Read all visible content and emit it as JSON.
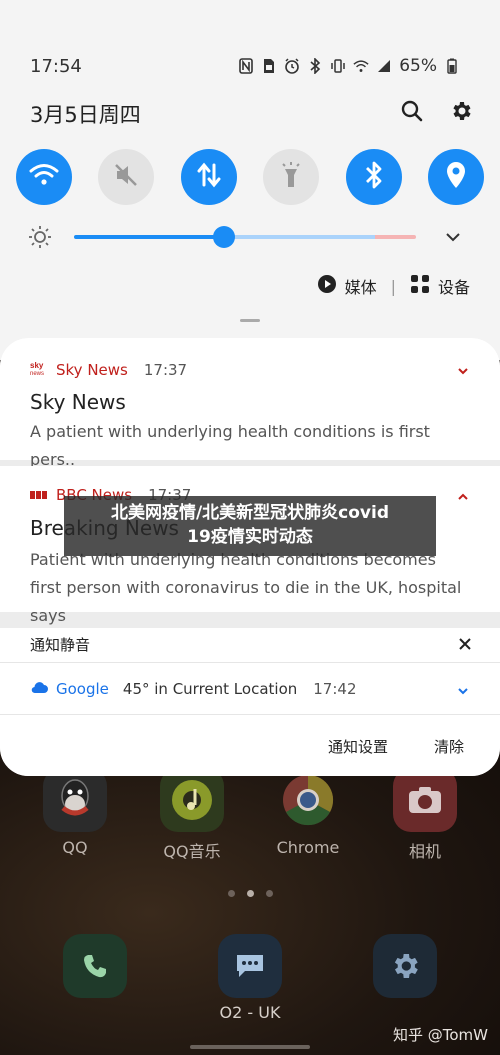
{
  "status_bar": {
    "time": "17:54",
    "battery": "65%",
    "icons": [
      "nfc-icon",
      "sim-icon",
      "alarm-icon",
      "bluetooth-icon",
      "vibrate-icon",
      "wifi-icon",
      "signal-icon",
      "battery-icon"
    ]
  },
  "header": {
    "date": "3月5日周四",
    "icons": [
      "search-icon",
      "gear-icon"
    ]
  },
  "quick_tiles": [
    {
      "icon": "wifi-icon",
      "active": true
    },
    {
      "icon": "mute-icon",
      "active": false
    },
    {
      "icon": "data-transfer-icon",
      "active": true
    },
    {
      "icon": "flashlight-icon",
      "active": false
    },
    {
      "icon": "bluetooth-icon",
      "active": true
    },
    {
      "icon": "location-icon",
      "active": true
    }
  ],
  "brightness": {
    "level": 0.44
  },
  "media_row": {
    "media_label": "媒体",
    "devices_label": "设备",
    "separator": "|"
  },
  "notifications": {
    "sky": {
      "app_name": "Sky News",
      "time": "17:37",
      "title": "Sky News",
      "body": "A patient with underlying health conditions is first pers.."
    },
    "bbc": {
      "app_name": "BBC News",
      "time": "17:37",
      "title": "Breaking News",
      "body": "Patient with underlying health conditions becomes first person with coronavirus to die in the UK, hospital says"
    },
    "silent_header": "通知静音",
    "google": {
      "app_name": "Google",
      "text": "45° in Current Location",
      "time": "17:42"
    },
    "footer": {
      "settings_label": "通知设置",
      "clear_label": "清除"
    }
  },
  "home": {
    "apps": [
      {
        "label": "QQ",
        "icon": "qq-icon"
      },
      {
        "label": "QQ音乐",
        "icon": "qq-music-icon"
      },
      {
        "label": "Chrome",
        "icon": "chrome-icon"
      },
      {
        "label": "相机",
        "icon": "camera-icon"
      }
    ],
    "dock_label": "O2 - UK",
    "dock_icons": [
      "phone-icon",
      "messages-icon",
      "settings-icon"
    ]
  },
  "caption": {
    "line1": "北美网疫情/北美新型冠状肺炎covid",
    "line2": "19疫情实时动态"
  },
  "watermark": "知乎 @TomW",
  "colors": {
    "accent": "#1a8cf5",
    "news_red": "#c0201c",
    "google_blue": "#1a73e8"
  }
}
